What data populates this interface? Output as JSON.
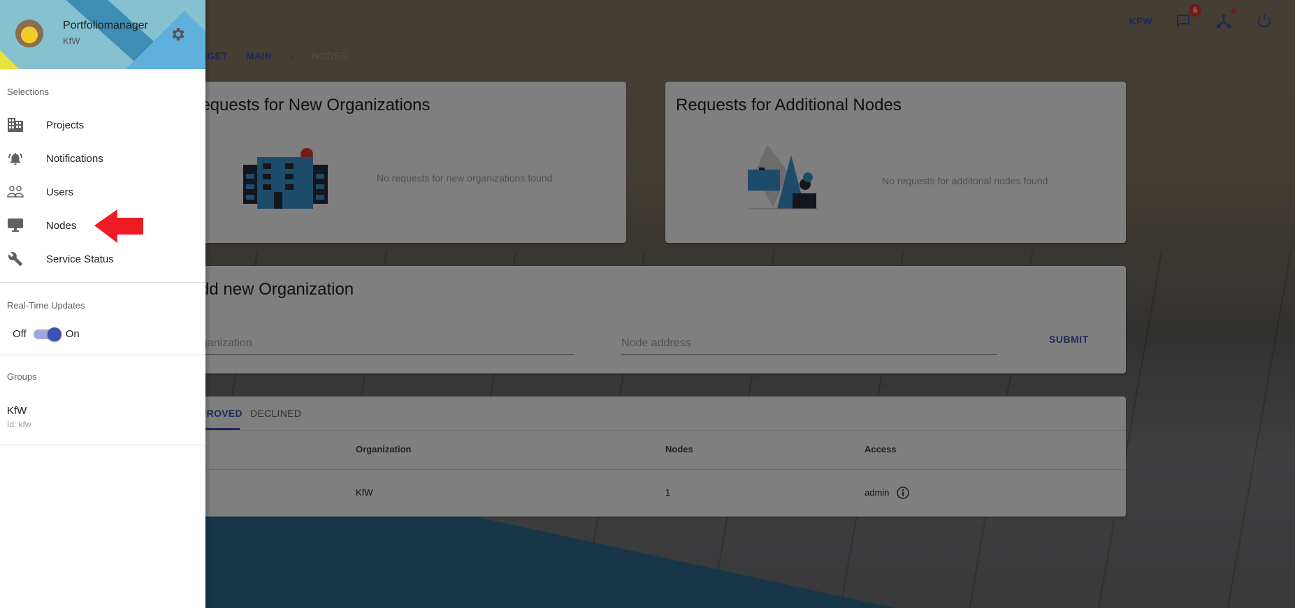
{
  "topbar": {
    "org_label": "KFW",
    "messages_badge": "6",
    "icons": [
      "message-icon",
      "network-icon",
      "power-icon"
    ]
  },
  "breadcrumb": {
    "items": [
      "BUDGET",
      "MAIN",
      "NODES"
    ],
    "separator": "›"
  },
  "cards": {
    "new_orgs": {
      "title": "Requests for New Organizations",
      "empty": "No requests for new organizations found"
    },
    "add_nodes": {
      "title": "Requests for Additional Nodes",
      "empty": "No requests for additonal nodes found"
    },
    "form": {
      "title": "Add new Organization",
      "org_placeholder": "Organization",
      "node_placeholder": "Node address",
      "submit": "SUBMIT"
    }
  },
  "table": {
    "tabs": [
      {
        "label": "APPROVED",
        "active": true
      },
      {
        "label": "DECLINED",
        "active": false
      }
    ],
    "headers": [
      "Organization",
      "Nodes",
      "Access"
    ],
    "rows": [
      {
        "organization": "KfW",
        "nodes": "1",
        "access": "admin"
      }
    ]
  },
  "sidebar": {
    "user": {
      "name": "Portfoliomanager",
      "org": "KfW"
    },
    "selections_label": "Selections",
    "items": [
      {
        "label": "Projects",
        "icon": "building-icon"
      },
      {
        "label": "Notifications",
        "icon": "bell-icon"
      },
      {
        "label": "Users",
        "icon": "users-icon"
      },
      {
        "label": "Nodes",
        "icon": "monitor-icon"
      },
      {
        "label": "Service Status",
        "icon": "wrench-icon"
      }
    ],
    "realtime_label": "Real-Time Updates",
    "toggle": {
      "off": "Off",
      "on": "On",
      "state": true
    },
    "groups_label": "Groups",
    "groups": [
      {
        "name": "KfW",
        "id": "Id: kfw"
      }
    ]
  },
  "colors": {
    "primary": "#3f51b5",
    "badge": "#e53935",
    "annotation_arrow": "#ed1c24"
  }
}
